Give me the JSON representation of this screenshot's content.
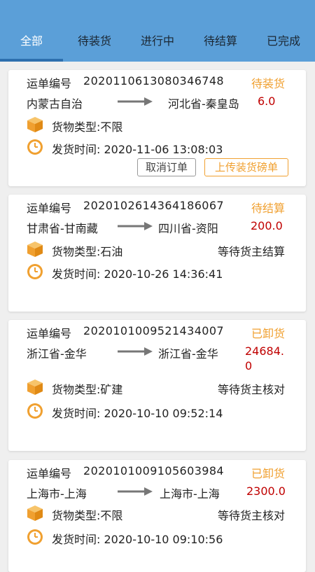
{
  "tabs": [
    "全部",
    "待装货",
    "进行中",
    "待结算",
    "已完成"
  ],
  "labels": {
    "order_no": "运单编号",
    "cargo_type_prefix": "货物类型:",
    "ship_time_prefix": "发货时间: "
  },
  "icons": {
    "box": "package-box-icon",
    "clock": "clock-icon",
    "arrow": "arrow-right-icon"
  },
  "colors": {
    "tab_bar": "#5b9fd8",
    "status_orange": "#f0a030",
    "price_red": "#c00000"
  },
  "orders": [
    {
      "order_no": "2020110613080346748",
      "status": "待装货",
      "from": "内蒙古自治",
      "to": "河北省-秦皇岛",
      "price": "6.0",
      "cargo_type": "货物类型:不限",
      "note": "",
      "ship_time": "发货时间: 2020-11-06 13:08:03",
      "buttons": [
        "取消订单",
        "上传装货磅单"
      ]
    },
    {
      "order_no": "2020102614364186067",
      "status": "待结算",
      "from": "甘肃省-甘南藏",
      "to": "四川省-资阳",
      "price": "200.0",
      "cargo_type": "货物类型:石油",
      "note": "等待货主结算",
      "ship_time": "发货时间: 2020-10-26 14:36:41"
    },
    {
      "order_no": "2020101009521434007",
      "status": "已卸货",
      "from": "浙江省-金华",
      "to": "浙江省-金华",
      "price_line1": "24684.",
      "price_line2": "0",
      "cargo_type": "货物类型:矿建",
      "note": "等待货主核对",
      "ship_time": "发货时间: 2020-10-10 09:52:14"
    },
    {
      "order_no": "2020101009105603984",
      "status": "已卸货",
      "from": "上海市-上海",
      "to": "上海市-上海",
      "price": "2300.0",
      "cargo_type": "货物类型:不限",
      "note": "等待货主核对",
      "ship_time": "发货时间: 2020-10-10 09:10:56"
    }
  ]
}
